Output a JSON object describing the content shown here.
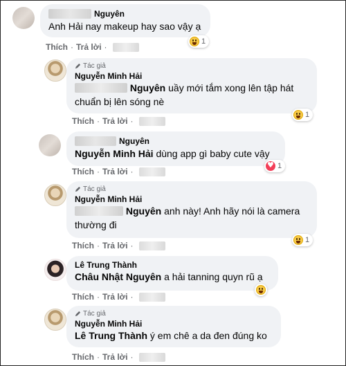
{
  "comments": [
    {
      "author": "Nguyên",
      "text": "Anh Hải nay makeup hay sao vậy ạ",
      "reaction_count": "1",
      "actions": {
        "like": "Thích",
        "reply": "Trả lời"
      }
    },
    {
      "author": "Nguyễn Minh Hải",
      "badge": "Tác giả",
      "mention": "Nguyên",
      "text_1": " uầy mới tắm xong lên tập hát",
      "text_2": "chuẩn bị lên sóng nè",
      "reaction_count": "1",
      "actions": {
        "like": "Thích",
        "reply": "Trả lời"
      }
    },
    {
      "author": "Nguyên",
      "mention_author": "Nguyễn Minh Hải",
      "text": " dùng app gì baby cute vậy",
      "reaction_count": "1",
      "actions": {
        "like": "Thích",
        "reply": "Trả lời"
      }
    },
    {
      "author": "Nguyễn Minh Hải",
      "badge": "Tác giả",
      "mention": "Nguyên",
      "text_1": " anh này! Anh hãy nói là camera",
      "text_2": "thường đi",
      "reaction_count": "1",
      "actions": {
        "like": "Thích",
        "reply": "Trả lời"
      }
    },
    {
      "author": "Lê Trung Thành",
      "mention": "Châu Nhật Nguyên",
      "text": " a hải tanning quyn rũ ạ",
      "actions": {
        "like": "Thích",
        "reply": "Trả lời"
      }
    },
    {
      "author": "Nguyễn Minh Hải",
      "badge": "Tác giả",
      "mention": "Lê Trung Thành",
      "text": " ý em chê a da đen đúng ko",
      "actions": {
        "like": "Thích",
        "reply": "Trả lời"
      }
    }
  ],
  "separator": "·",
  "icons": {
    "reaction_laugh": "haha-reaction-icon",
    "reaction_love": "love-reaction-icon",
    "author_badge": "pen-icon"
  }
}
